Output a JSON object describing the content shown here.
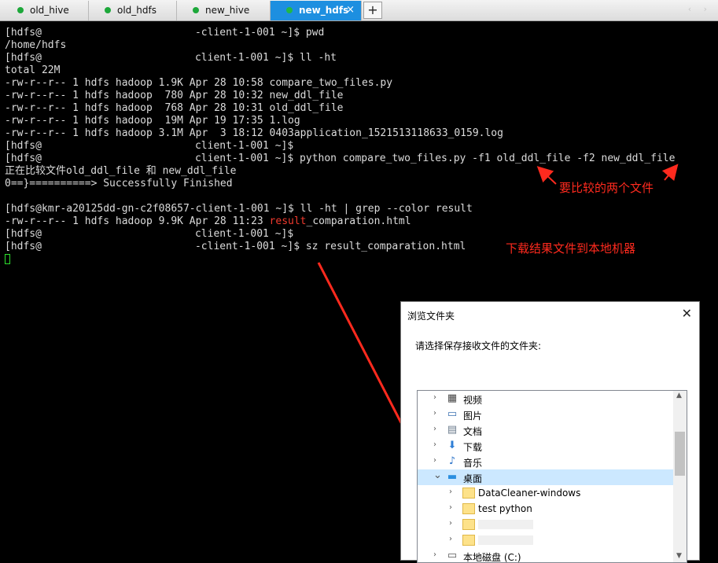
{
  "tabs": [
    {
      "label": "old_hive"
    },
    {
      "label": "old_hdfs"
    },
    {
      "label": "new_hive"
    },
    {
      "label": "new_hdfs",
      "close": "×"
    }
  ],
  "add_tab": "+",
  "nav_arrows": "‹ ›",
  "terminal": {
    "lines": [
      {
        "a": "[hdfs@",
        "b": "-client-1-001 ~]$ pwd"
      },
      {
        "a": "/home/hdfs",
        "b": ""
      },
      {
        "a": "[hdfs@",
        "b": "client-1-001 ~]$ ll -ht"
      },
      {
        "a": "total 22M",
        "b": ""
      },
      {
        "a": "-rw-r--r-- 1 hdfs hadoop 1.9K Apr 28 10:58 compare_two_files.py",
        "b": ""
      },
      {
        "a": "-rw-r--r-- 1 hdfs hadoop  780 Apr 28 10:32 new_ddl_file",
        "b": ""
      },
      {
        "a": "-rw-r--r-- 1 hdfs hadoop  768 Apr 28 10:31 old_ddl_file",
        "b": ""
      },
      {
        "a": "-rw-r--r-- 1 hdfs hadoop  19M Apr 19 17:35 1.log",
        "b": ""
      },
      {
        "a": "-rw-r--r-- 1 hdfs hadoop 3.1M Apr  3 18:12 0403application_1521513118633_0159.log",
        "b": ""
      },
      {
        "a": "[hdfs@",
        "b": "client-1-001 ~]$"
      },
      {
        "a": "[hdfs@",
        "b": "client-1-001 ~]$ python compare_two_files.py -f1 old_ddl_file -f2 new_ddl_file"
      },
      {
        "a": "正在比较文件old_ddl_file 和 new_ddl_file",
        "b": ""
      },
      {
        "a": "0==}==========> Successfully Finished",
        "b": ""
      },
      {
        "a": "",
        "b": ""
      },
      {
        "a": "[hdfs@kmr-a20125dd-gn-c2f08657-client-1-001 ~]$ ll -ht | grep --color result",
        "b": ""
      },
      {
        "a": "-rw-r--r-- 1 hdfs hadoop 9.9K Apr 28 11:23 ",
        "hl": "result",
        "b": "_comparation.html"
      },
      {
        "a": "[hdfs@",
        "b": "client-1-001 ~]$"
      },
      {
        "a": "[hdfs@",
        "b": "-client-1-001 ~]$ sz result_comparation.html"
      }
    ]
  },
  "annotations": {
    "compare_note": "要比较的两个文件",
    "download_note": "下载结果文件到本地机器"
  },
  "dialog": {
    "title": "浏览文件夹",
    "close": "✕",
    "prompt": "请选择保存接收文件的文件夹:",
    "items": [
      {
        "label": "视频",
        "icon": "video-icon",
        "glyph": "▦",
        "color": "#444444"
      },
      {
        "label": "图片",
        "icon": "pictures-icon",
        "glyph": "▭",
        "color": "#3a6fb0"
      },
      {
        "label": "文档",
        "icon": "documents-icon",
        "glyph": "▤",
        "color": "#6b7b8c"
      },
      {
        "label": "下载",
        "icon": "download-icon",
        "glyph": "⬇",
        "color": "#2f7fd6"
      },
      {
        "label": "音乐",
        "icon": "music-icon",
        "glyph": "♪",
        "color": "#2b73c9"
      },
      {
        "label": "桌面",
        "icon": "desktop-icon",
        "glyph": "▬",
        "color": "#2b8fe0",
        "expanded": true,
        "selected": true
      },
      {
        "label": "DataCleaner-windows",
        "icon": "folder-icon"
      },
      {
        "label": "test python",
        "icon": "folder-icon"
      },
      {
        "label": "",
        "icon": "folder-icon"
      },
      {
        "label": "",
        "icon": "folder-icon"
      },
      {
        "label": "本地磁盘 (C:)",
        "icon": "drive-icon"
      }
    ]
  }
}
